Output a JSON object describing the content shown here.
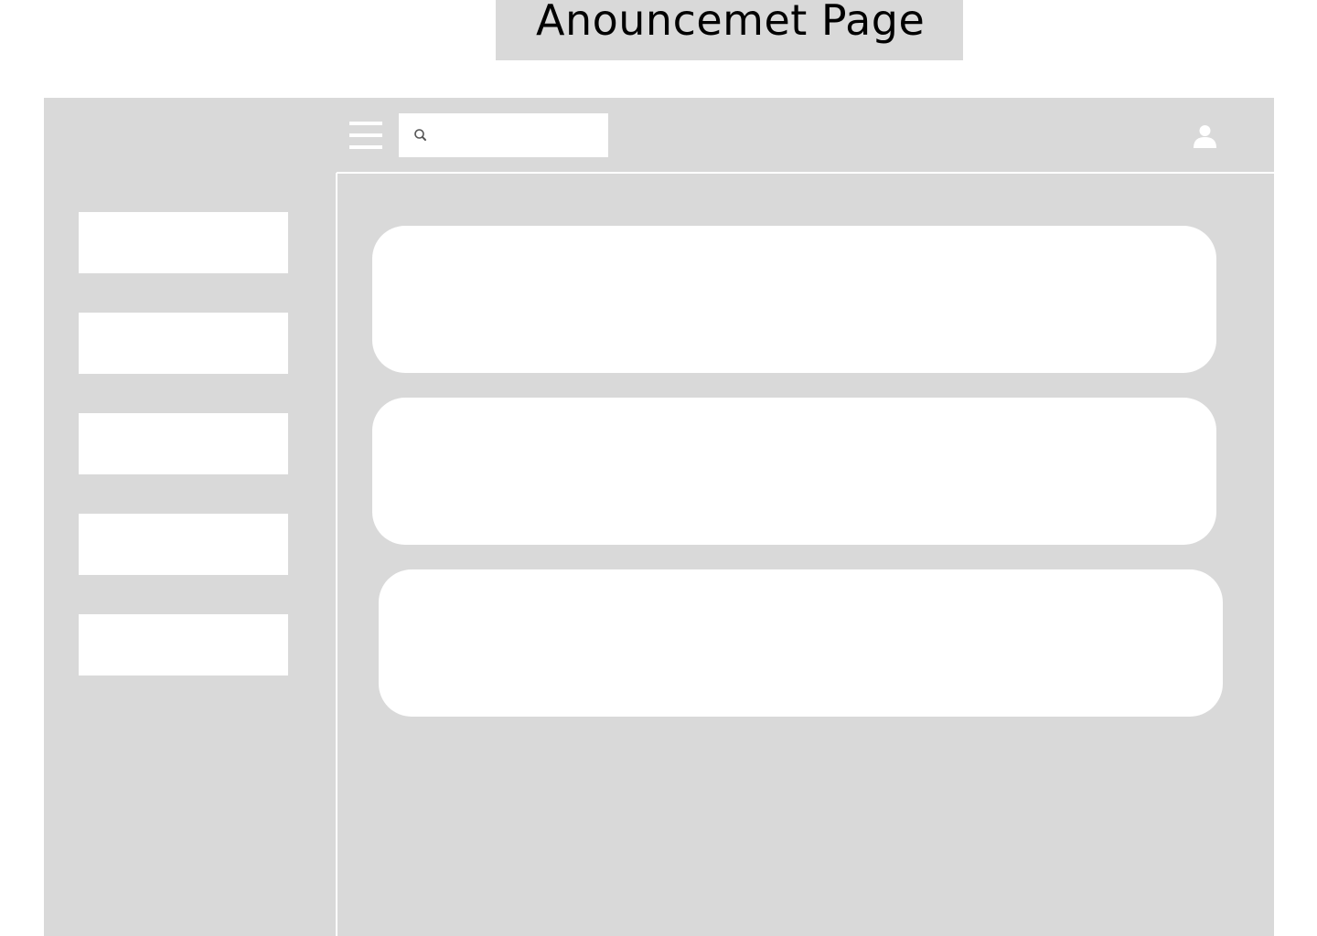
{
  "page_title": "Anouncemet Page",
  "header": {
    "menu_icon": "hamburger-menu-icon",
    "search": {
      "icon": "search-icon",
      "placeholder": "",
      "value": ""
    },
    "user_icon": "user-profile-icon"
  },
  "sidebar": {
    "items": [
      {
        "label": ""
      },
      {
        "label": ""
      },
      {
        "label": ""
      },
      {
        "label": ""
      },
      {
        "label": ""
      }
    ]
  },
  "main": {
    "announcements": [
      {
        "text": ""
      },
      {
        "text": ""
      },
      {
        "text": ""
      }
    ]
  },
  "colors": {
    "frame_background": "#d9d9d9",
    "panel": "#ffffff",
    "title_text": "#000000"
  }
}
